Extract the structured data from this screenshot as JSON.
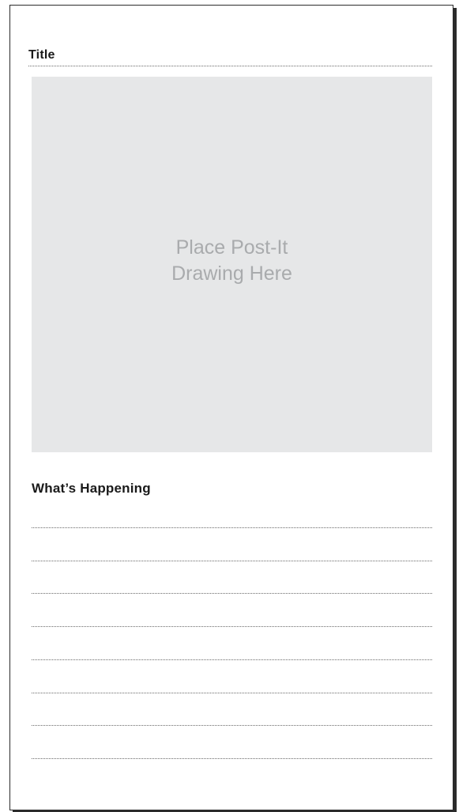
{
  "header": {
    "title_label": "Title"
  },
  "drawing_area": {
    "placeholder_line1": "Place Post-It",
    "placeholder_line2": "Drawing Here"
  },
  "notes": {
    "heading": "What’s Happening",
    "line_count": 8
  },
  "colors": {
    "drawing_background": "#e6e7e8",
    "placeholder_text": "#a9abad",
    "text": "#1a1a1a"
  }
}
